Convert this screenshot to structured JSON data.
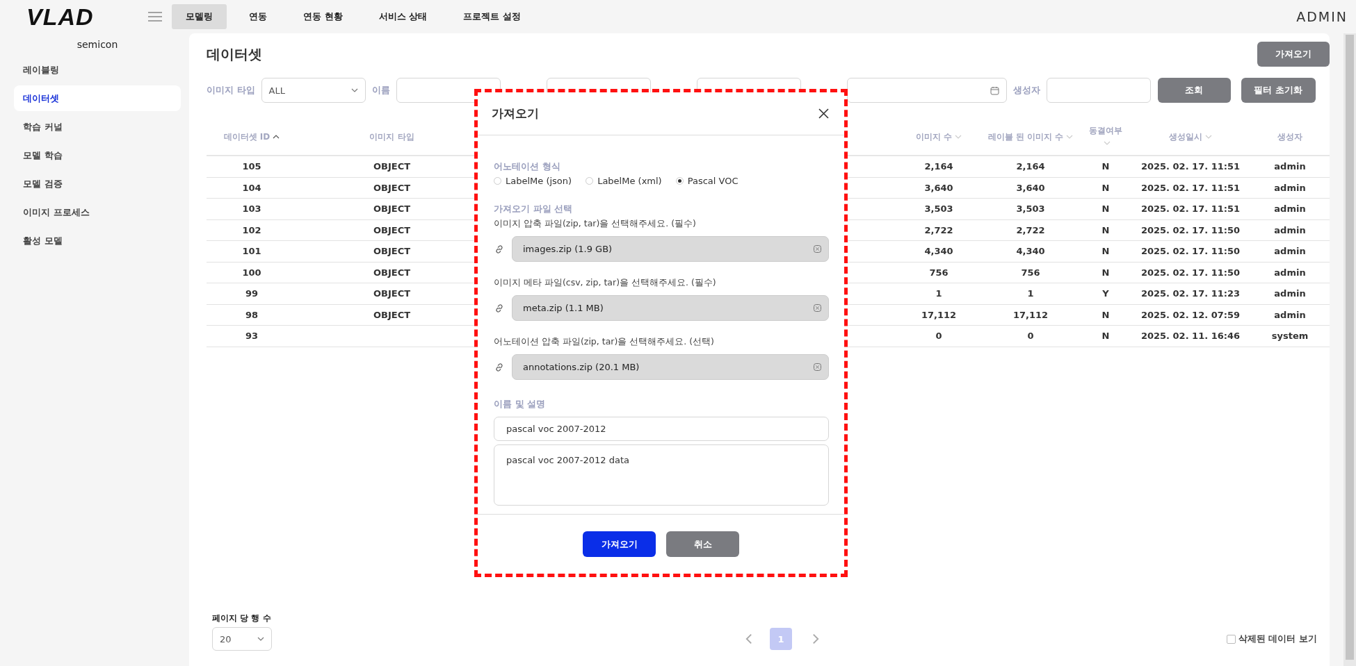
{
  "header": {
    "logo": "VLAD",
    "nav": [
      {
        "label": "모델링",
        "selected": true
      },
      {
        "label": "연동",
        "selected": false
      },
      {
        "label": "연동 현황",
        "selected": false
      },
      {
        "label": "서비스 상태",
        "selected": false
      },
      {
        "label": "프로젝트 설정",
        "selected": false
      }
    ],
    "user": "ADMIN"
  },
  "sidebar": {
    "workspace": "semicon",
    "items": [
      {
        "label": "레이블링",
        "selected": false
      },
      {
        "label": "데이터셋",
        "selected": true
      },
      {
        "label": "학습 커널",
        "selected": false
      },
      {
        "label": "모델 학습",
        "selected": false
      },
      {
        "label": "모델 검증",
        "selected": false
      },
      {
        "label": "이미지 프로세스",
        "selected": false
      },
      {
        "label": "활성 모델",
        "selected": false
      }
    ]
  },
  "page": {
    "title": "데이터셋",
    "import_button": "가져오기"
  },
  "filters": [
    {
      "kind": "select",
      "label": "이미지 타입",
      "value": "ALL"
    },
    {
      "kind": "text",
      "label": "이름"
    },
    {
      "kind": "select"
    },
    {
      "kind": "select"
    },
    {
      "kind": "date"
    },
    {
      "kind": "text",
      "label": "생성자"
    }
  ],
  "filter_buttons": [
    "조회",
    "필터 초기화"
  ],
  "table": {
    "columns": [
      {
        "label": "데이터셋 ID",
        "sorted": true
      },
      {
        "label": "이미지 타입"
      },
      {
        "label": "이미지 수",
        "sorted": false
      },
      {
        "label": "레이블 된 이미지 수",
        "sorted": false
      },
      {
        "label": "동결여부",
        "sorted": false
      },
      {
        "label": "생성일시",
        "sorted": false
      },
      {
        "label": "생성자"
      }
    ],
    "rows": [
      [
        "105",
        "OBJECT",
        "2,164",
        "2,164",
        "N",
        "2025. 02. 17. 11:51",
        "admin"
      ],
      [
        "104",
        "OBJECT",
        "3,640",
        "3,640",
        "N",
        "2025. 02. 17. 11:51",
        "admin"
      ],
      [
        "103",
        "OBJECT",
        "3,503",
        "3,503",
        "N",
        "2025. 02. 17. 11:51",
        "admin"
      ],
      [
        "102",
        "OBJECT",
        "2,722",
        "2,722",
        "N",
        "2025. 02. 17. 11:50",
        "admin"
      ],
      [
        "101",
        "OBJECT",
        "4,340",
        "4,340",
        "N",
        "2025. 02. 17. 11:50",
        "admin"
      ],
      [
        "100",
        "OBJECT",
        "756",
        "756",
        "N",
        "2025. 02. 17. 11:50",
        "admin"
      ],
      [
        "99",
        "OBJECT",
        "1",
        "1",
        "Y",
        "2025. 02. 17. 11:23",
        "admin"
      ],
      [
        "98",
        "OBJECT",
        "17,112",
        "17,112",
        "N",
        "2025. 02. 12. 07:59",
        "admin"
      ],
      [
        "93",
        "",
        "0",
        "0",
        "N",
        "2025. 02. 11. 16:46",
        "system"
      ]
    ]
  },
  "footer": {
    "rows_per_page_label": "페이지 당 행 수",
    "rows_per_page": "20",
    "pages": [
      {
        "label": "1",
        "selected": true
      }
    ],
    "show_deleted": {
      "label": "삭제된 데이터 보기",
      "checked": false
    }
  },
  "dialog": {
    "title": "가져오기",
    "format_label": "어노테이션 형식",
    "formats": [
      {
        "label": "LabelMe (json)",
        "selected": false
      },
      {
        "label": "LabelMe (xml)",
        "selected": false
      },
      {
        "label": "Pascal VOC",
        "selected": true
      }
    ],
    "file_section_label": "가져오기 파일 선택",
    "files": [
      {
        "hint": "이미지 압축 파일(zip, tar)을 선택해주세요. (필수)",
        "value": "images.zip (1.9 GB)"
      },
      {
        "hint": "이미지 메타 파일(csv, zip, tar)을 선택해주세요. (필수)",
        "value": "meta.zip (1.1 MB)"
      },
      {
        "hint": "어노테이션 압축 파일(zip, tar)을 선택해주세요. (선택)",
        "value": "annotations.zip (20.1 MB)"
      }
    ],
    "name_section_label": "이름 및 설명",
    "name": "pascal voc 2007-2012",
    "description": "pascal voc 2007-2012 data",
    "buttons": [
      {
        "label": "가져오기",
        "kind": "primary"
      },
      {
        "label": "취소",
        "kind": "secondary"
      }
    ]
  }
}
